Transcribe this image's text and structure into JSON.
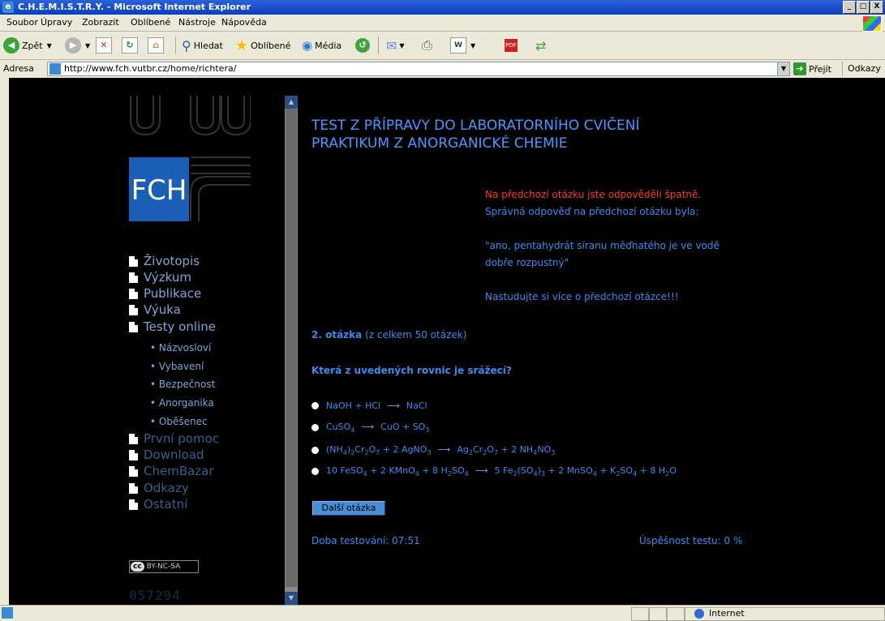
{
  "window": {
    "title": "C.H.E.M.I.S.T.R.Y. - Microsoft Internet Explorer",
    "buttons": [
      "_",
      "□",
      "X"
    ]
  },
  "menu": [
    "Soubor",
    "Úpravy",
    "Zobrazit",
    "Oblíbené",
    "Nástroje",
    "Nápověda"
  ],
  "toolbar": {
    "back_label": "Zpět",
    "search_label": "Hledat",
    "favorites_label": "Oblíbené",
    "media_label": "Média"
  },
  "address": {
    "label": "Adresa",
    "url": "http://www.fch.vutbr.cz/home/richtera/",
    "go_label": "Přejít",
    "links_label": "Odkazy"
  },
  "sidebar": {
    "logo_text": "FCH",
    "items": [
      "Životopis",
      "Výzkum",
      "Publikace",
      "Výuka",
      "Testy online"
    ],
    "subitems": [
      "Názvosloví",
      "Vybavení",
      "Bezpečnost",
      "Anorganika",
      "Oběšenec"
    ],
    "items2": [
      "První pomoc",
      "Download",
      "ChemBazar",
      "Odkazy",
      "Ostatní"
    ],
    "cc_label": "BY-NC-SA",
    "counter": "057294"
  },
  "content": {
    "heading_line1": "TEST Z PŘÍPRAVY DO LABORATORNÍHO CVIČENÍ",
    "heading_line2": "PRAKTIKUM Z ANORGANICKÉ CHEMIE",
    "wrong_answer": "Na předchozí otázku jste odpověděli špatně.",
    "correct_was": "Správná odpověď na předchozí otázku byla:",
    "correct_answer_1": "\"ano, pentahydrát síranu měďnatého je ve vodě",
    "correct_answer_2": "dobře rozpustný\"",
    "study_more": "Nastudujte si více o předchozí otázce!!!",
    "question_number": "2. otázka",
    "question_total": "(z celkem 50 otázek)",
    "question": "Která z uvedených rovnic je srážecí?",
    "next_button": "Další otázka",
    "timer_label": "Doba testování: 07:51",
    "success_label": "Úspěšnost testu: 0 %"
  },
  "status": {
    "zone": "Internet"
  }
}
